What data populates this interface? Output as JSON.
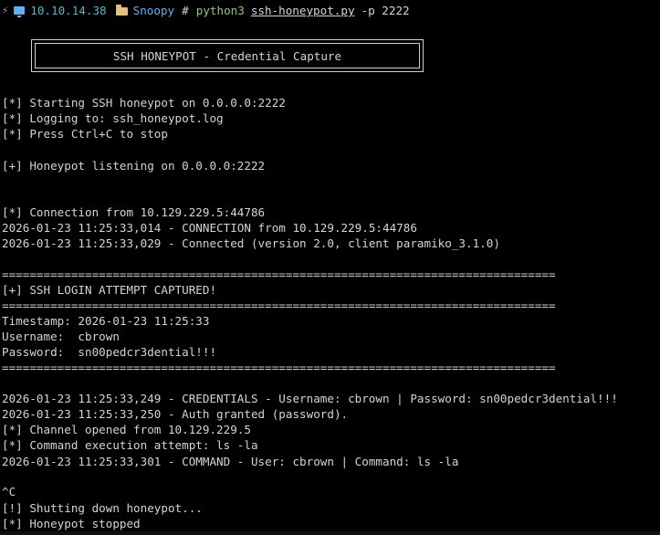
{
  "prompt": {
    "ip": "10.10.14.38",
    "directory": "Snoopy",
    "symbol": "#",
    "command": "python3",
    "script": "ssh-honeypot.py",
    "args": "-p 2222",
    "icons": [
      "bolt-icon",
      "monitor-icon",
      "folder-icon"
    ]
  },
  "banner": {
    "title": "SSH HONEYPOT - Credential Capture"
  },
  "output": {
    "start": "[*] Starting SSH honeypot on 0.0.0.0:2222",
    "logging": "[*] Logging to: ssh_honeypot.log",
    "stop_hint": "[*] Press Ctrl+C to stop",
    "listening": "[+] Honeypot listening on 0.0.0.0:2222",
    "connection": "[*] Connection from 10.129.229.5:44786",
    "log_connection": "2026-01-23 11:25:33,014 - CONNECTION from 10.129.229.5:44786",
    "log_connected": "2026-01-23 11:25:33,029 - Connected (version 2.0, client paramiko_3.1.0)",
    "rule": "================================================================================",
    "captured": "[+] SSH LOGIN ATTEMPT CAPTURED!",
    "timestamp": "Timestamp: 2026-01-23 11:25:33",
    "username": "Username:  cbrown",
    "password": "Password:  sn00pedcr3dential!!!",
    "log_credentials": "2026-01-23 11:25:33,249 - CREDENTIALS - Username: cbrown | Password: sn00pedcr3dential!!!",
    "log_auth": "2026-01-23 11:25:33,250 - Auth granted (password).",
    "channel": "[*] Channel opened from 10.129.229.5",
    "exec_attempt": "[*] Command execution attempt: ls -la",
    "log_command": "2026-01-23 11:25:33,301 - COMMAND - User: cbrown | Command: ls -la",
    "ctrl_c": "^C",
    "shutdown": "[!] Shutting down honeypot...",
    "stopped": "[*] Honeypot stopped"
  },
  "colors": {
    "background": "#000000",
    "text": "#d4d4d4",
    "ip": "#56b6c2",
    "directory": "#61afef",
    "command": "#98c379",
    "bolt": "#c678dd",
    "folder": "#e5c07b"
  }
}
